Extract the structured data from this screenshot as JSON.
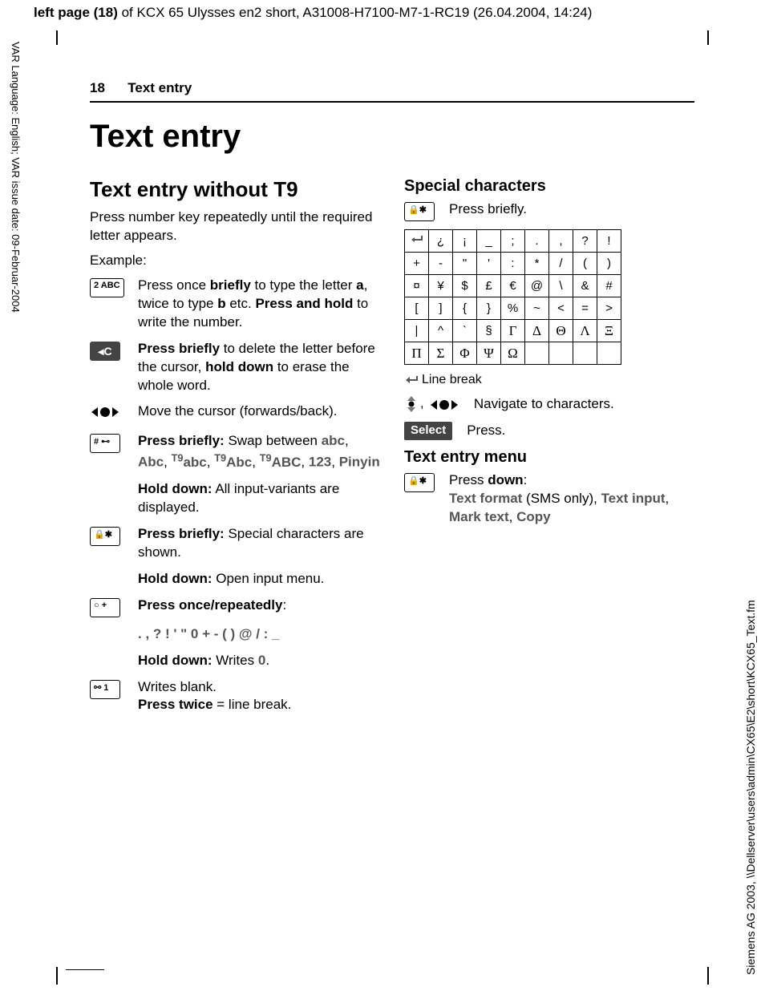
{
  "header": {
    "prefix_bold": "left page (18)",
    "rest": " of KCX 65 Ulysses en2 short, A31008-H7100-M7-1-RC19 (26.04.2004, 14:24)"
  },
  "side_left": "VAR Language: English; VAR issue date: 09-Februar-2004",
  "side_right": "Siemens AG 2003, \\\\Dellserver\\users\\admin\\CX65\\E2\\short\\KCX65_Text.fm",
  "running_head": {
    "num": "18",
    "title": "Text entry"
  },
  "title": "Text entry",
  "left": {
    "h2": "Text entry without T9",
    "intro": "Press number key repeatedly until the required letter appears.",
    "example_label": "Example:",
    "rows": [
      {
        "key": "2 ABC",
        "type": "box",
        "html": "Press once <b>briefly</b> to type the letter <b>a</b>, twice to type <b>b</b> etc. <b>Press and hold</b> to write the number."
      },
      {
        "key": "◂C",
        "type": "c",
        "html": "<b>Press briefly</b> to delete the letter before the cursor, <b>hold down</b> to erase the whole word."
      },
      {
        "key": "nav",
        "type": "nav",
        "html": "Move the cursor (forwards/back)."
      },
      {
        "key": "# ⊷",
        "type": "box",
        "html": "<b>Press briefly:</b> Swap between <span class='gray'>abc</span>, <span class='gray'>Abc</span>, <span class='gray'><span class='sup'>T9</span>abc</span>, <span class='gray'><span class='sup'>T9</span>Abc</span>, <span class='gray'><span class='sup'>T9</span>ABC</span>, <span class='gray'>123</span>, <span class='gray'>Pinyin</span>"
      },
      {
        "key": "",
        "type": "blank",
        "html": "<b>Hold down:</b> All input-variants are displayed."
      },
      {
        "key": "🔒✱",
        "type": "box",
        "html": "<b>Press briefly:</b> Special characters are shown."
      },
      {
        "key": "",
        "type": "blank",
        "html": "<b>Hold down:</b> Open input menu."
      },
      {
        "key": "○ +",
        "type": "box",
        "html": "<b>Press once/repeatedly</b>:"
      },
      {
        "key": "",
        "type": "blank",
        "html": "<b class='gray'>. , ? ! ' \" 0 + - ( ) @ / : _</b>"
      },
      {
        "key": "",
        "type": "blank",
        "html": "<b>Hold down:</b> Writes <span class='gray'>0</span>."
      },
      {
        "key": "⚯ 1",
        "type": "box",
        "html": "Writes blank.<br><b>Press twice</b> = line break."
      }
    ]
  },
  "right": {
    "h3_special": "Special characters",
    "key_star": "🔒✱",
    "press_briefly": "Press briefly.",
    "table": [
      [
        "↵",
        "¿",
        "¡",
        "_",
        ";",
        ".",
        ",",
        "?",
        "!"
      ],
      [
        "+",
        "-",
        "\"",
        "'",
        ":",
        "*",
        "/",
        "(",
        ")"
      ],
      [
        "¤",
        "¥",
        "$",
        "£",
        "€",
        "@",
        "\\",
        "&",
        "#"
      ],
      [
        "[",
        "]",
        "{",
        "}",
        "%",
        "~",
        "<",
        "=",
        ">"
      ],
      [
        "|",
        "^",
        "`",
        "§",
        "Γ",
        "Δ",
        "Θ",
        "Λ",
        "Ξ"
      ],
      [
        "Π",
        "Σ",
        "Φ",
        "Ψ",
        "Ω",
        "",
        "",
        "",
        ""
      ]
    ],
    "line_break": "Line break",
    "nav_label": "Navigate to characters.",
    "select_key": "Select",
    "press": "Press.",
    "h3_menu": "Text entry menu",
    "menu_key": "🔒✱",
    "menu_press": "Press <b>down</b>:",
    "menu_items": "<span class='gray'>Text format</span> (SMS only), <span class='gray'>Text input</span>, <span class='gray'>Mark text</span>, <span class='gray'>Copy</span>"
  }
}
